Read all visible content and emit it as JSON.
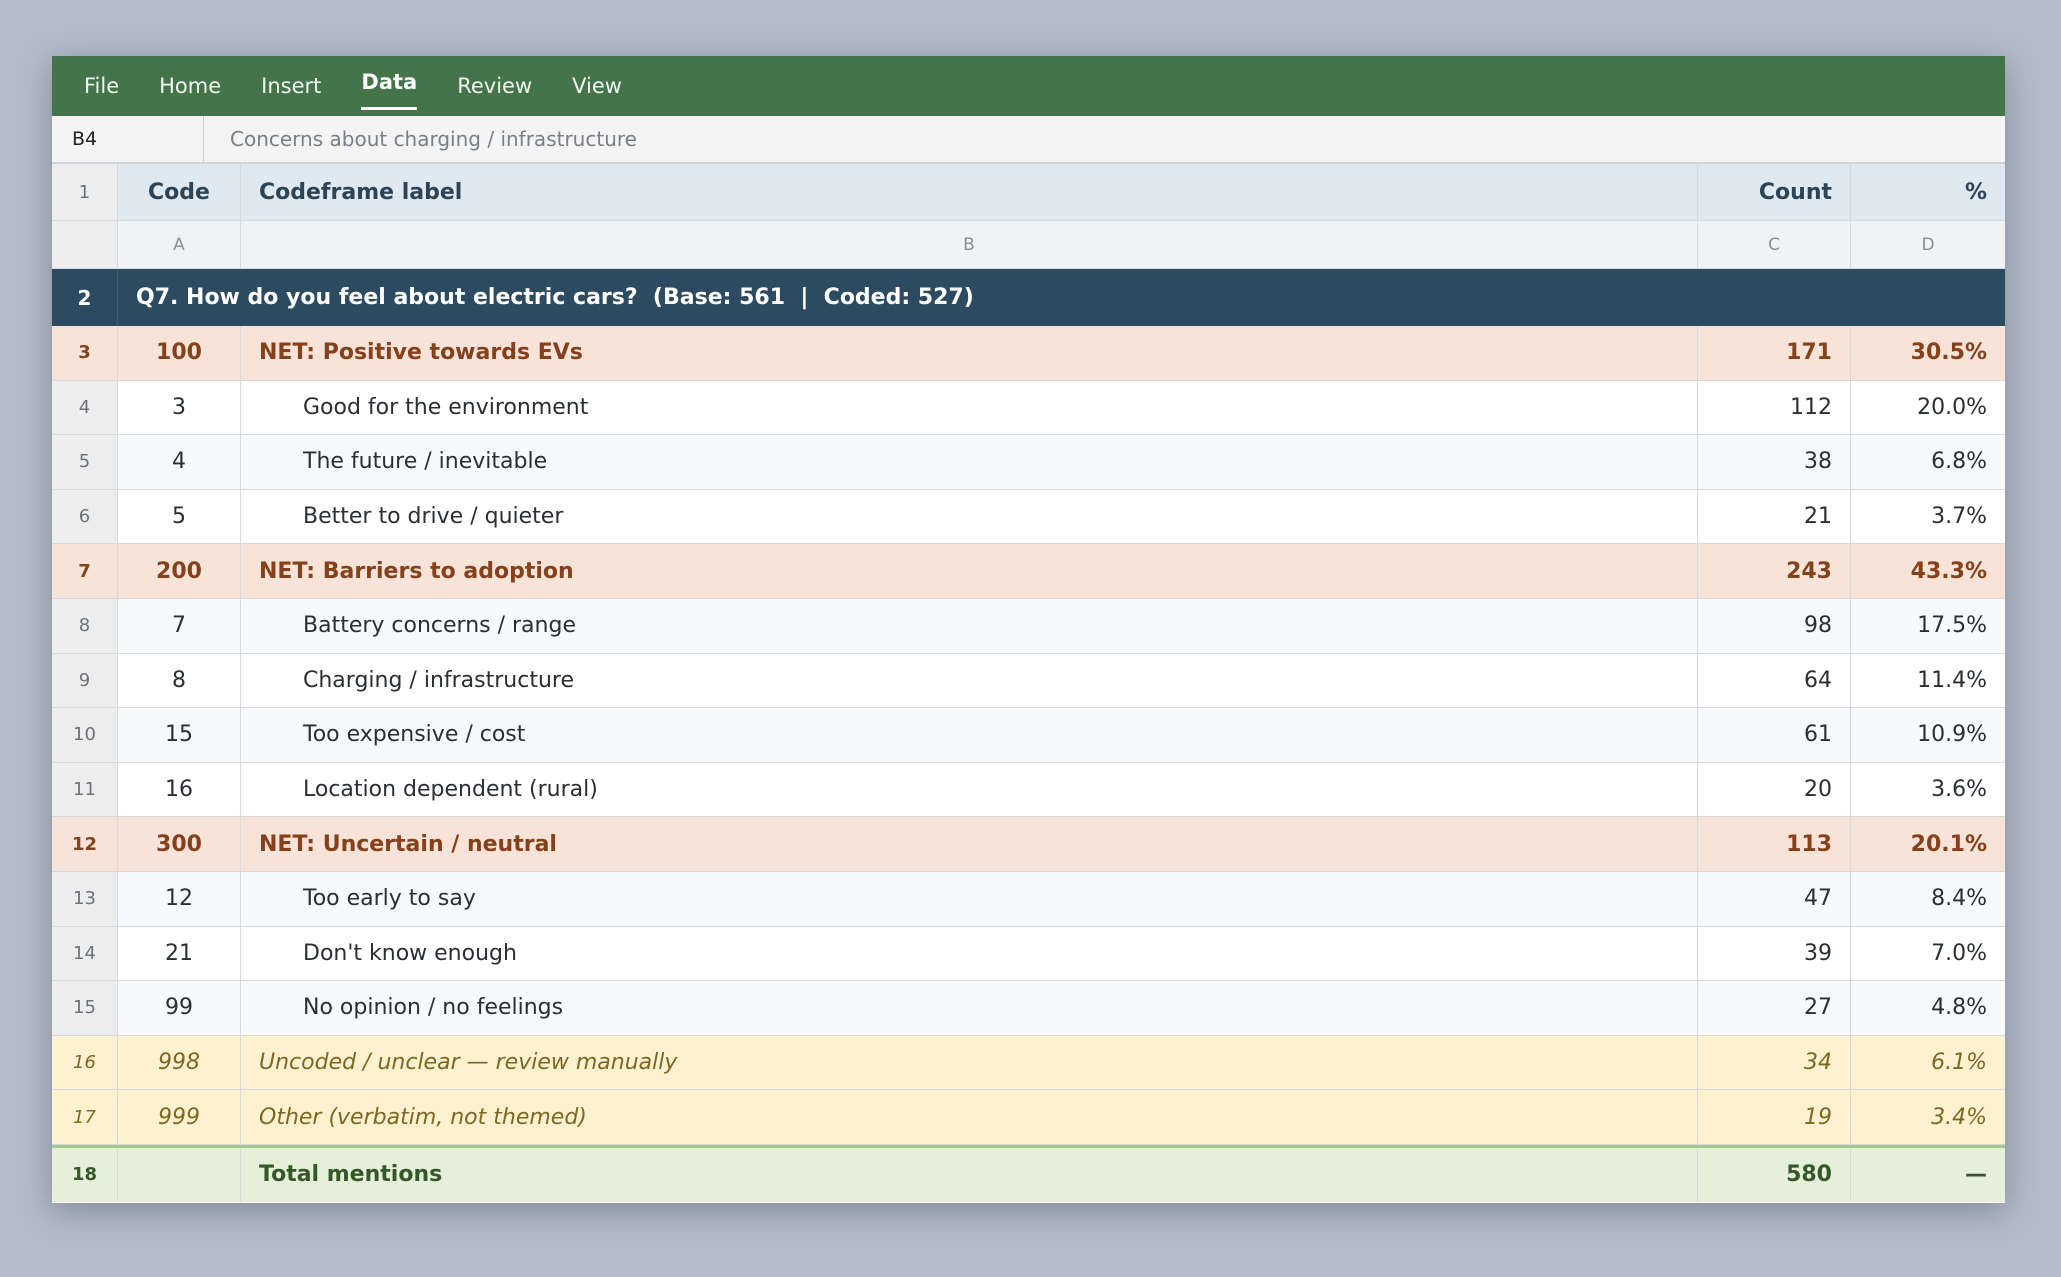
{
  "menu": [
    "File",
    "Home",
    "Insert",
    "Data",
    "Review",
    "View"
  ],
  "active_menu": "Data",
  "formula_bar": {
    "cell_ref": "B4",
    "content": "Concerns about charging / infrastructure"
  },
  "header": {
    "row_num": "1",
    "code": "Code",
    "label": "Codeframe label",
    "count": "Count",
    "pct": "%"
  },
  "column_letters": [
    "A",
    "B",
    "C",
    "D"
  ],
  "question": {
    "row_num": "2",
    "text": "Q7. How do you feel about electric cars?  (Base: 561  |  Coded: 527)"
  },
  "rows": [
    {
      "n": "3",
      "type": "net",
      "code": "100",
      "label": "NET: Positive towards EVs",
      "count": "171",
      "pct": "30.5%"
    },
    {
      "n": "4",
      "type": "item",
      "code": "3",
      "label": "Good for the environment",
      "count": "112",
      "pct": "20.0%"
    },
    {
      "n": "5",
      "type": "item",
      "code": "4",
      "label": "The future / inevitable",
      "count": "38",
      "pct": "6.8%"
    },
    {
      "n": "6",
      "type": "item",
      "code": "5",
      "label": "Better to drive / quieter",
      "count": "21",
      "pct": "3.7%"
    },
    {
      "n": "7",
      "type": "net",
      "code": "200",
      "label": "NET: Barriers to adoption",
      "count": "243",
      "pct": "43.3%"
    },
    {
      "n": "8",
      "type": "item",
      "code": "7",
      "label": "Battery concerns / range",
      "count": "98",
      "pct": "17.5%"
    },
    {
      "n": "9",
      "type": "item",
      "code": "8",
      "label": "Charging / infrastructure",
      "count": "64",
      "pct": "11.4%"
    },
    {
      "n": "10",
      "type": "item",
      "code": "15",
      "label": "Too expensive / cost",
      "count": "61",
      "pct": "10.9%"
    },
    {
      "n": "11",
      "type": "item",
      "code": "16",
      "label": "Location dependent (rural)",
      "count": "20",
      "pct": "3.6%"
    },
    {
      "n": "12",
      "type": "net",
      "code": "300",
      "label": "NET: Uncertain / neutral",
      "count": "113",
      "pct": "20.1%"
    },
    {
      "n": "13",
      "type": "item",
      "code": "12",
      "label": "Too early to say",
      "count": "47",
      "pct": "8.4%"
    },
    {
      "n": "14",
      "type": "item",
      "code": "21",
      "label": "Don't know enough",
      "count": "39",
      "pct": "7.0%"
    },
    {
      "n": "15",
      "type": "item",
      "code": "99",
      "label": "No opinion / no feelings",
      "count": "27",
      "pct": "4.8%"
    },
    {
      "n": "16",
      "type": "flag",
      "code": "998",
      "label": "Uncoded / unclear — review manually",
      "count": "34",
      "pct": "6.1%"
    },
    {
      "n": "17",
      "type": "flag",
      "code": "999",
      "label": "Other (verbatim, not themed)",
      "count": "19",
      "pct": "3.4%"
    }
  ],
  "total": {
    "n": "18",
    "code": "",
    "label": "Total mentions",
    "count": "580",
    "pct": "—"
  },
  "colors": {
    "ribbon": "#44754a",
    "question_band": "#2d4b60",
    "net_row": "#f7e3d7",
    "flag_row": "#fdf1cf",
    "total_row": "#e6efda"
  }
}
